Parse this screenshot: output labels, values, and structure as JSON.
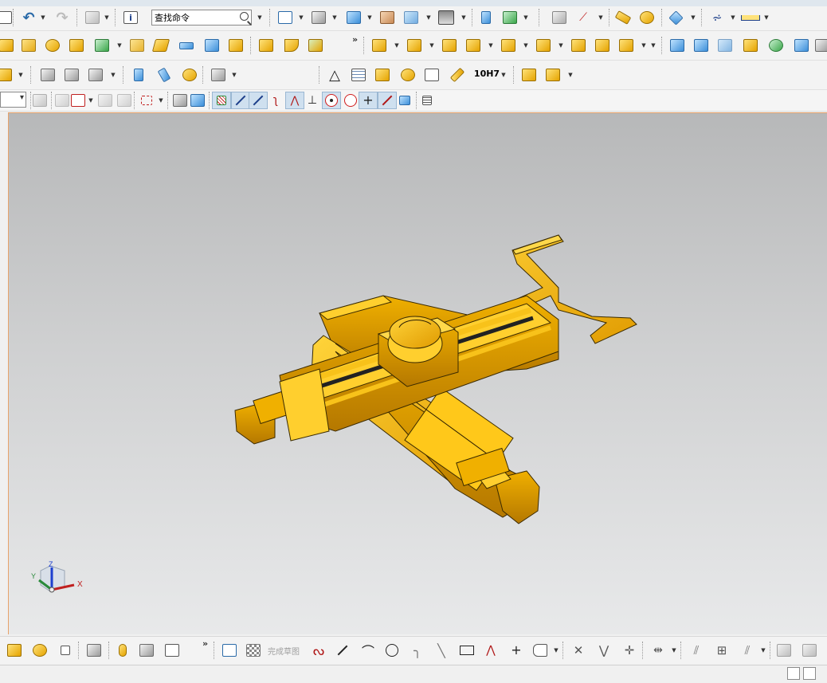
{
  "app": {
    "search_placeholder": "查找命令",
    "more": "»"
  },
  "toolbar_row1": {
    "icons": [
      "copy-icon",
      "undo-icon",
      "redo-icon",
      "open-icon",
      "information-icon",
      "fit-view-icon",
      "shaded-view-icon",
      "cube-view-icon",
      "section-view-icon",
      "background-icon",
      "move-icon",
      "snap-view-icon",
      "layers-icon",
      "csys-icon",
      "measure-icon",
      "analysis-icon",
      "appearance-icon",
      "annotation-icon",
      "dimension-icon"
    ]
  },
  "toolbar_row3": {
    "fit_label": "10H7"
  },
  "toolbar_row4": {
    "combo_value": ""
  },
  "sketch_bar": {
    "finish_sketch": "完成草图"
  },
  "colors": {
    "model": "#f5b400",
    "viewport_top": "#b7b8b9",
    "viewport_bottom": "#e8e9ea",
    "viewport_border": "#e7a26a"
  },
  "triad": {
    "x": "X",
    "y": "Y",
    "z": "Z"
  }
}
